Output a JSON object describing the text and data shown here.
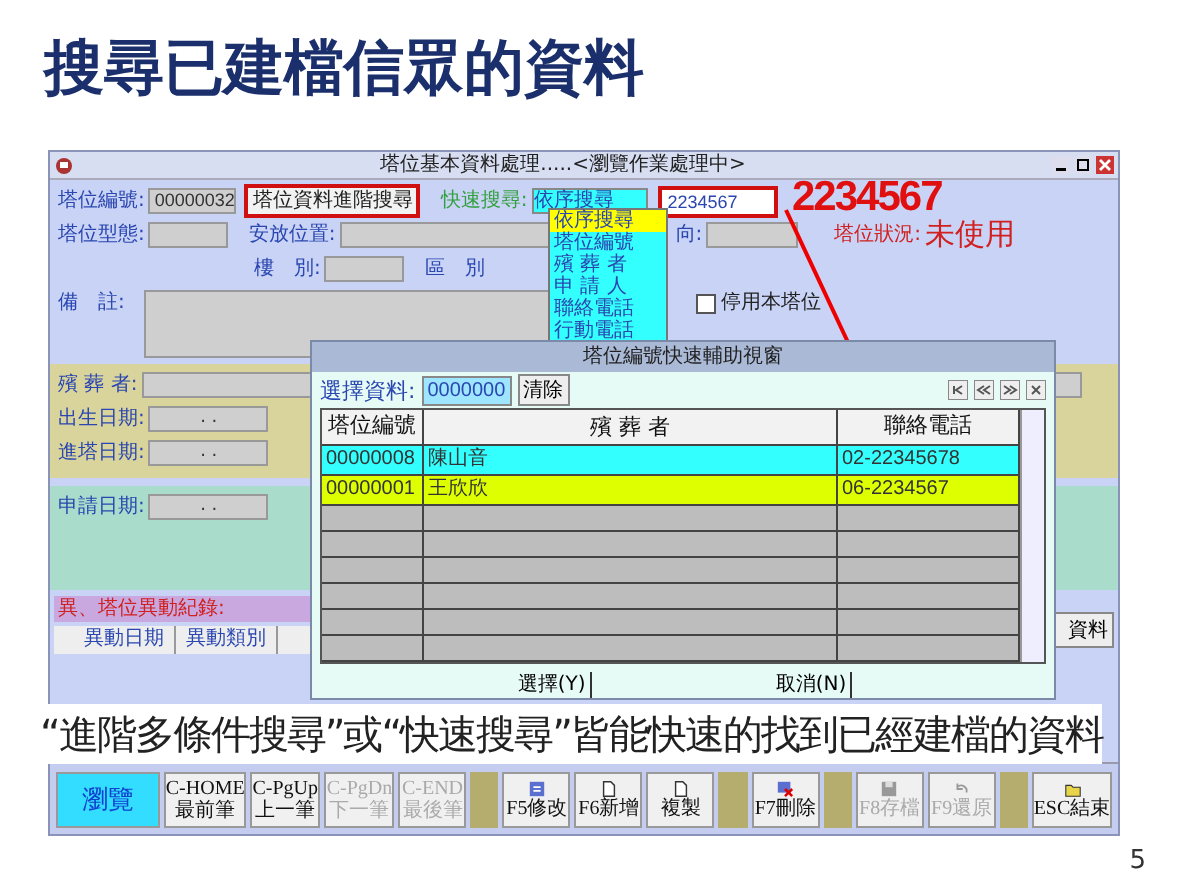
{
  "slide": {
    "title": "搜尋已建檔信眾的資料",
    "caption": "“進階多條件搜尋”或“快速搜尋”皆能快速的找到已經建檔的資料",
    "page_number": "5"
  },
  "window": {
    "title": "塔位基本資料處理.....<瀏覽作業處理中>"
  },
  "form": {
    "slot_no": {
      "label": "塔位編號:",
      "value": "00000032"
    },
    "advanced_search_button": "塔位資料進階搜尋",
    "quick_search": {
      "label": "快速搜尋:",
      "mode": "依序搜尋",
      "value": "2234567",
      "options": [
        {
          "label": "依序搜尋",
          "selected": true
        },
        {
          "label": "塔位編號",
          "selected": false
        },
        {
          "label": "殯 葬 者",
          "selected": false
        },
        {
          "label": "申 請 人",
          "selected": false
        },
        {
          "label": "聯絡電話",
          "selected": false
        },
        {
          "label": "行動電話",
          "selected": false
        }
      ]
    },
    "slot_type": {
      "label": "塔位型態:"
    },
    "location": {
      "label": "安放位置:"
    },
    "facing": {
      "label": "向:"
    },
    "status": {
      "label": "塔位狀況:",
      "value": "未使用"
    },
    "floor": {
      "label": "樓　別:"
    },
    "area": {
      "label": "區　別"
    },
    "remarks": {
      "label": "備　註:"
    },
    "disable_slot": {
      "label": "停用本塔位",
      "checked": false
    },
    "deceased": {
      "label": "殯 葬 者:"
    },
    "birth_date": {
      "label": "出生日期:",
      "value": ". ."
    },
    "entry_date": {
      "label": "進塔日期:",
      "value": ". ."
    },
    "application_date": {
      "label": "申請日期:",
      "value": ". ."
    },
    "history": {
      "title": "異、塔位異動紀錄:",
      "columns": [
        "異動日期",
        "異動類別"
      ]
    },
    "side_button": "資料"
  },
  "annotation": {
    "text": "2234567"
  },
  "dialog": {
    "title": "塔位編號快速輔助視窗",
    "filter": {
      "label": "選擇資料:",
      "value": "0000000"
    },
    "clear_button": "清除",
    "columns": [
      "塔位編號",
      "殯 葬 者",
      "聯絡電話"
    ],
    "rows": [
      {
        "cells": [
          "00000008",
          "陳山音",
          "02-22345678"
        ],
        "color": "#33ffff"
      },
      {
        "cells": [
          "00000001",
          "王欣欣",
          "06-2234567"
        ],
        "color": "#ddff00"
      }
    ],
    "buttons": [
      "選擇(Y)",
      "取消(N)"
    ]
  },
  "toolbar": {
    "groups": [
      [
        {
          "lines": [
            "瀏覽"
          ],
          "kind": "text",
          "selected": true,
          "disabled": false
        },
        {
          "lines": [
            "C-HOME",
            "最前筆"
          ],
          "kind": "text",
          "selected": false,
          "disabled": false
        },
        {
          "lines": [
            "C-PgUp",
            "上一筆"
          ],
          "kind": "text",
          "selected": false,
          "disabled": false
        },
        {
          "lines": [
            "C-PgDn",
            "下一筆"
          ],
          "kind": "text",
          "selected": false,
          "disabled": true
        },
        {
          "lines": [
            "C-END",
            "最後筆"
          ],
          "kind": "text",
          "selected": false,
          "disabled": true
        }
      ],
      [
        {
          "lines": [
            "F5修改"
          ],
          "kind": "edit",
          "selected": false,
          "disabled": false
        },
        {
          "lines": [
            "F6新增"
          ],
          "kind": "new",
          "selected": false,
          "disabled": false
        },
        {
          "lines": [
            "複製"
          ],
          "kind": "copy",
          "selected": false,
          "disabled": false
        }
      ],
      [
        {
          "lines": [
            "F7刪除"
          ],
          "kind": "delete",
          "selected": false,
          "disabled": false
        }
      ],
      [
        {
          "lines": [
            "F8存檔"
          ],
          "kind": "save",
          "selected": false,
          "disabled": true
        },
        {
          "lines": [
            "F9還原"
          ],
          "kind": "undo",
          "selected": false,
          "disabled": true
        }
      ],
      [
        {
          "lines": [
            "ESC結束"
          ],
          "kind": "exit",
          "selected": false,
          "disabled": false
        }
      ]
    ]
  }
}
